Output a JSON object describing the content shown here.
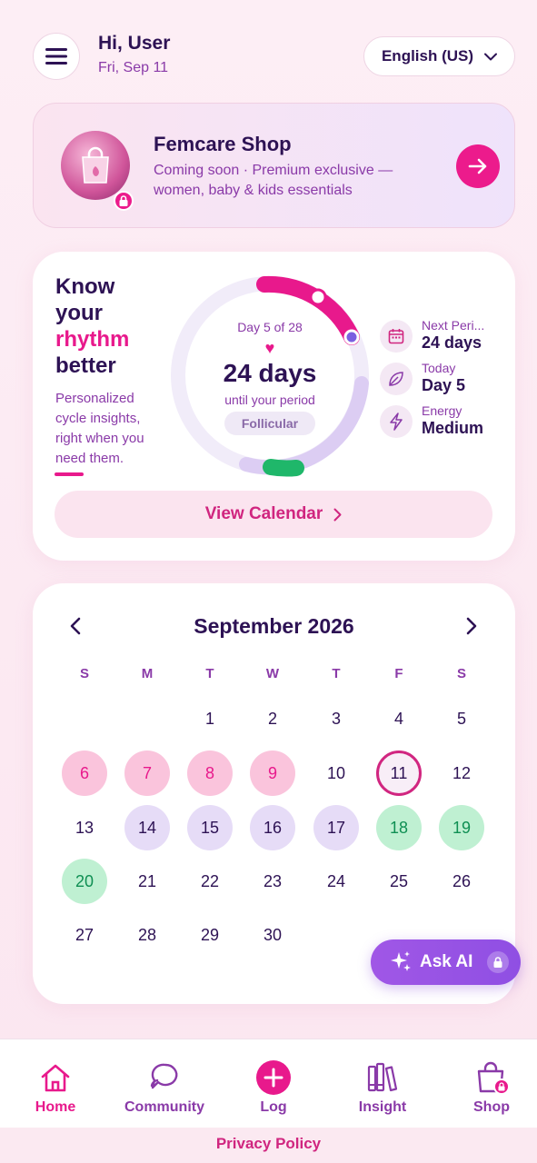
{
  "header": {
    "greeting": "Hi, User",
    "date": "Fri, Sep 11",
    "language": "English (US)"
  },
  "shop_card": {
    "title": "Femcare Shop",
    "subtitle": "Coming soon · Premium exclusive — women, baby & kids essentials"
  },
  "rhythm": {
    "title_line1": "Know",
    "title_line2": "your",
    "title_line3": "rhythm",
    "title_line4": "better",
    "subtitle": "Personalized cycle insights, right when you need them.",
    "cycle_day": "Day 5 of 28",
    "countdown": "24 days",
    "countdown_caption": "until your period",
    "phase": "Follicular",
    "cycle_progress": 0.1786,
    "stats": [
      {
        "icon": "calendar-icon",
        "label": "Next Peri...",
        "value": "24 days"
      },
      {
        "icon": "leaf-icon",
        "label": "Today",
        "value": "Day 5"
      },
      {
        "icon": "lightning-icon",
        "label": "Energy",
        "value": "Medium"
      }
    ],
    "view_calendar": "View Calendar"
  },
  "calendar": {
    "month": "September 2026",
    "weekdays": [
      "S",
      "M",
      "T",
      "W",
      "T",
      "F",
      "S"
    ],
    "first_weekday_index": 2,
    "days_in_month": 30,
    "today": 11,
    "period_days": [
      6,
      7,
      8,
      9
    ],
    "fertile_days": [
      14,
      15,
      16,
      17
    ],
    "ovulation_days": [
      18,
      19,
      20
    ]
  },
  "ask_ai": {
    "label": "Ask AI"
  },
  "bottom_nav": [
    {
      "label": "Home",
      "icon": "home-icon",
      "active": true
    },
    {
      "label": "Community",
      "icon": "chat-icon",
      "active": false
    },
    {
      "label": "Log",
      "icon": "plus-icon",
      "active": false
    },
    {
      "label": "Insight",
      "icon": "books-icon",
      "active": false
    },
    {
      "label": "Shop",
      "icon": "shopping-bag-icon",
      "active": false
    }
  ],
  "footer": {
    "privacy": "Privacy Policy"
  },
  "colors": {
    "accent_pink": "#e8198c",
    "deep_purple": "#2d1254",
    "muted_purple": "#8a3aa8",
    "period": "#fac4dc",
    "fertile": "#e6dcf7",
    "ovulation": "#bff0d2"
  }
}
